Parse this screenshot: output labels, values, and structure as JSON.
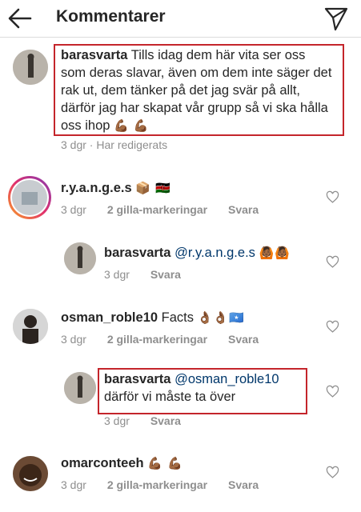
{
  "header": {
    "title": "Kommentarer",
    "back_icon": "arrow-left-icon",
    "send_icon": "send-paper-plane-icon"
  },
  "comments": [
    {
      "user": "barasvarta",
      "text": "Tills idag dem här vita ser oss som deras slavar, även om dem inte säger det rak ut, dem tänker på det jag svär på allt, därför jag har skapat vår grupp så vi ska hålla oss ihop",
      "emoji": "💪🏾 💪🏾",
      "time": "3 dgr",
      "extra": "Har redigerats"
    },
    {
      "user": "r.y.a.n.g.e.s",
      "emoji": "📦 🇰🇪",
      "time": "3 dgr",
      "likes": "2 gilla-markeringar",
      "reply": "Svara"
    },
    {
      "user": "barasvarta",
      "mention": "@r.y.a.n.g.e.s",
      "emoji": "🙆🏾🙆🏾",
      "time": "3 dgr",
      "reply": "Svara"
    },
    {
      "user": "osman_roble10",
      "text": "Facts",
      "emoji": "👌🏾👌🏾🇸🇴",
      "time": "3 dgr",
      "likes": "2 gilla-markeringar",
      "reply": "Svara"
    },
    {
      "user": "barasvarta",
      "mention": "@osman_roble10",
      "text": "därför vi måste ta över",
      "time": "3 dgr",
      "reply": "Svara"
    },
    {
      "user": "omarconteeh",
      "emoji": "💪🏾 💪🏾",
      "time": "3 dgr",
      "likes": "2 gilla-markeringar",
      "reply": "Svara"
    }
  ],
  "colors": {
    "highlight_box": "#c4252b",
    "mention": "#00376b",
    "meta": "#8e8e8e"
  }
}
